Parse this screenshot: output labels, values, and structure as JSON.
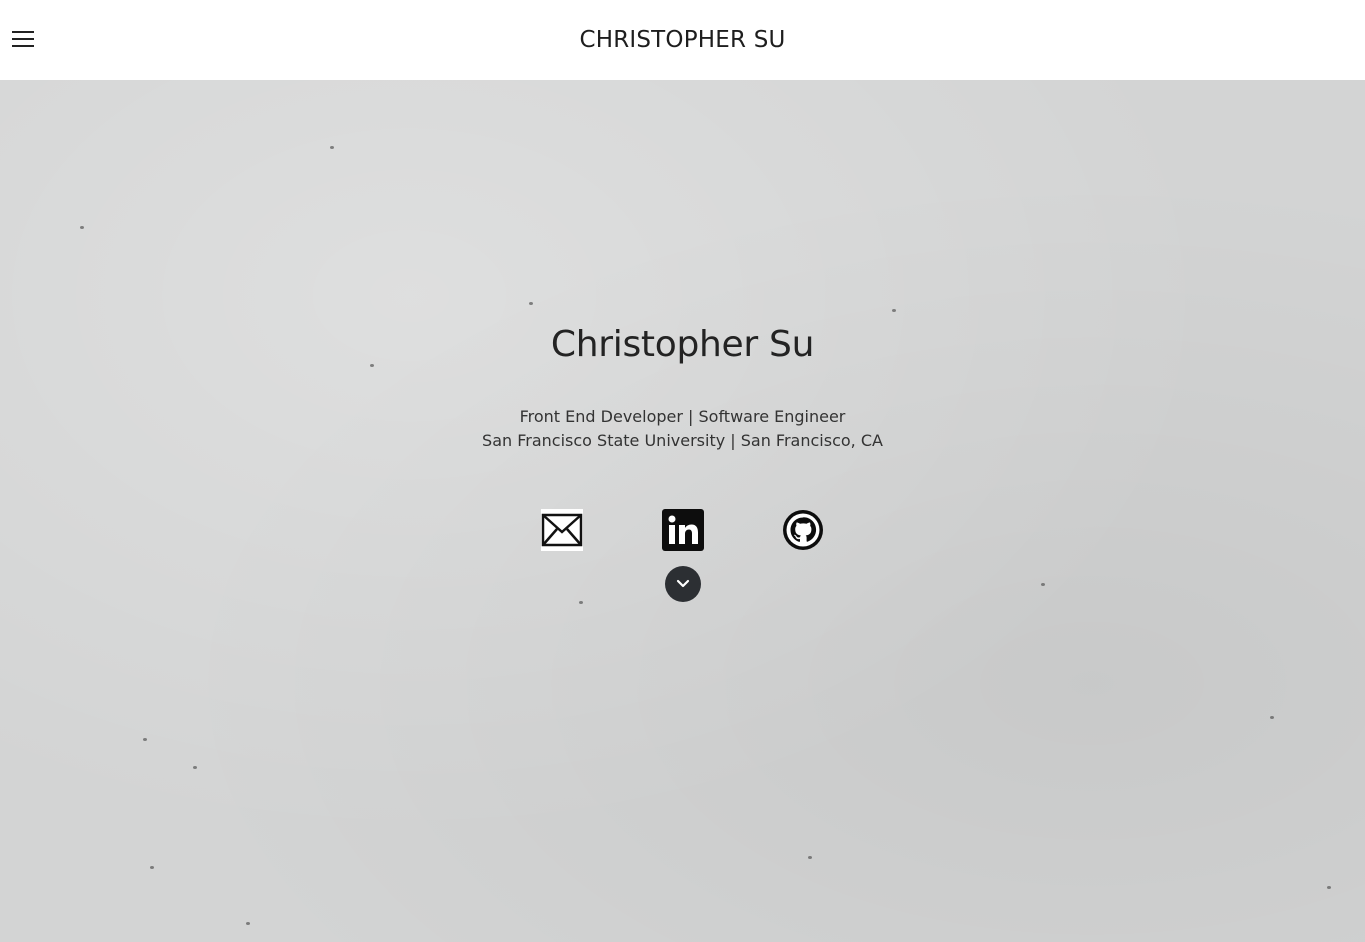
{
  "navbar": {
    "brand": "CHRISTOPHER SU",
    "menu_icon": "hamburger-menu-icon"
  },
  "hero": {
    "title": "Christopher Su",
    "subtitle_line1": "Front End Developer | Software Engineer",
    "subtitle_line2": "San Francisco State University | San Francisco, CA"
  },
  "social": [
    {
      "icon": "email-icon",
      "label": "Email"
    },
    {
      "icon": "linkedin-icon",
      "label": "LinkedIn"
    },
    {
      "icon": "github-icon",
      "label": "GitHub"
    }
  ],
  "scroll": {
    "icon": "chevron-down-icon"
  },
  "colors": {
    "background": "#d3d4d4",
    "navbar": "#ffffff",
    "text": "#222222",
    "scroll_button": "#2c2f33"
  }
}
